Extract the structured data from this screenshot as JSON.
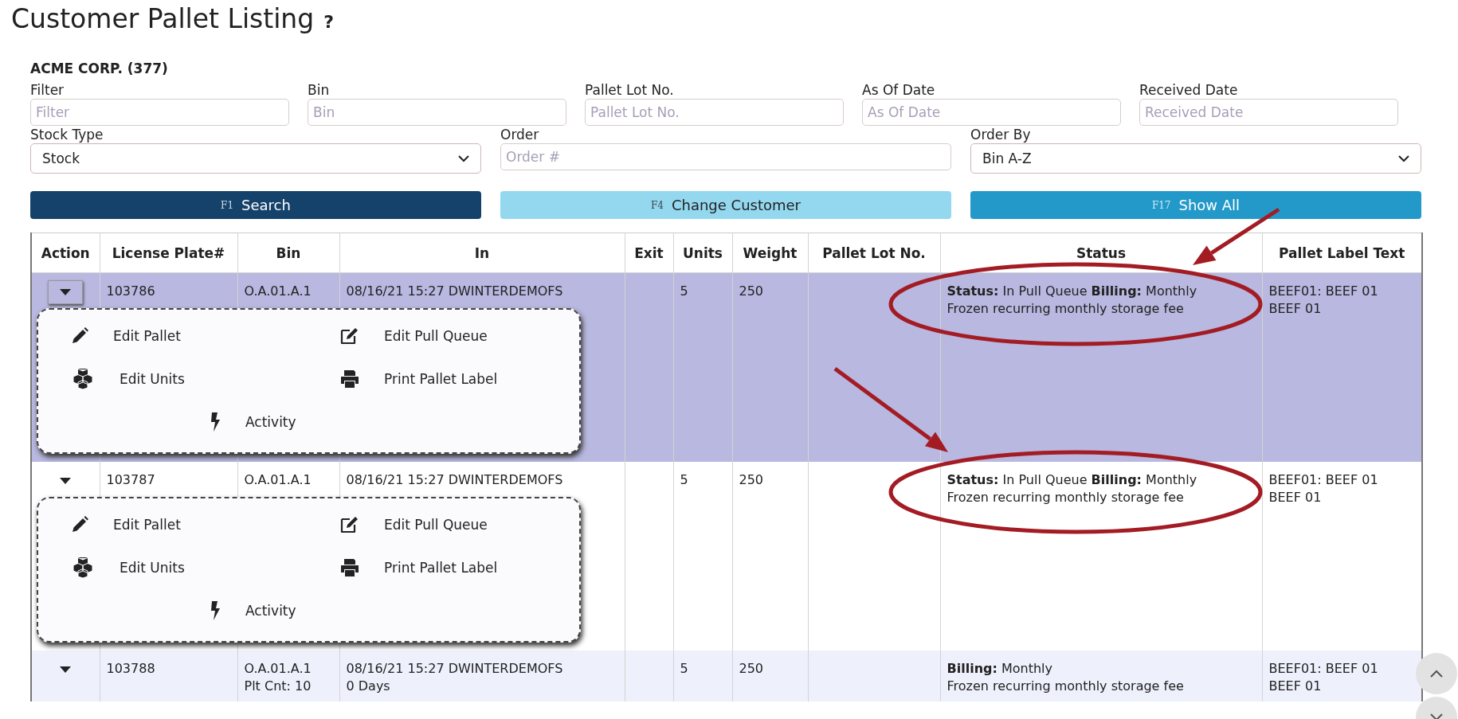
{
  "title": "Customer Pallet Listing",
  "help": "?",
  "customer": "ACME CORP. (377)",
  "filters_top": [
    {
      "kind": "text",
      "label": "Filter",
      "placeholder": "Filter"
    },
    {
      "kind": "text",
      "label": "Bin",
      "placeholder": "Bin"
    },
    {
      "kind": "text",
      "label": "Pallet Lot No.",
      "placeholder": "Pallet Lot No."
    },
    {
      "kind": "text",
      "label": "As Of Date",
      "placeholder": "As Of Date"
    },
    {
      "kind": "text",
      "label": "Received Date",
      "placeholder": "Received Date"
    }
  ],
  "filters_bottom": [
    {
      "kind": "select",
      "label": "Stock Type",
      "value": "Stock"
    },
    {
      "kind": "text",
      "label": "Order",
      "placeholder": "Order #"
    },
    {
      "kind": "select",
      "label": "Order By",
      "value": "Bin A-Z"
    }
  ],
  "buttons": [
    {
      "kind": "primary",
      "key": "F1",
      "label": "Search"
    },
    {
      "kind": "light",
      "key": "F4",
      "label": "Change Customer"
    },
    {
      "kind": "info",
      "key": "F17",
      "label": "Show All"
    }
  ],
  "table": {
    "columns": [
      "Action",
      "License Plate#",
      "Bin",
      "In",
      "Exit",
      "Units",
      "Weight",
      "Pallet Lot No.",
      "Status",
      "Pallet Label Text"
    ],
    "rows": [
      {
        "selected": true,
        "license_plate": "103786",
        "bin": [
          "O.A.01.A.1"
        ],
        "in": [
          "08/16/21 15:27 DWINTERDEMOFS"
        ],
        "units": "5",
        "weight": "250",
        "status": [
          "**Status:** In Pull Queue **Billing:** Monthly",
          "Frozen recurring monthly storage fee"
        ],
        "label_text": [
          "BEEF01: BEEF 01",
          "BEEF 01"
        ],
        "menu": [
          "Edit Pallet",
          "Edit Pull Queue",
          "Edit Units",
          "Print Pallet Label",
          "Activity"
        ]
      },
      {
        "selected": false,
        "license_plate": "103787",
        "bin": [
          "O.A.01.A.1"
        ],
        "in": [
          "08/16/21 15:27 DWINTERDEMOFS"
        ],
        "units": "5",
        "weight": "250",
        "status": [
          "**Status:** In Pull Queue **Billing:** Monthly",
          "Frozen recurring monthly storage fee"
        ],
        "label_text": [
          "BEEF01: BEEF 01",
          "BEEF 01"
        ],
        "menu": [
          "Edit Pallet",
          "Edit Pull Queue",
          "Edit Units",
          "Print Pallet Label",
          "Activity"
        ]
      },
      {
        "selected": false,
        "license_plate": "103788",
        "bin": [
          "O.A.01.A.1",
          "Plt Cnt: 10"
        ],
        "in": [
          "08/16/21 15:27 DWINTERDEMOFS",
          "0 Days"
        ],
        "units": "5",
        "weight": "250",
        "status": [
          "**Billing:** Monthly",
          "Frozen recurring monthly storage fee"
        ],
        "label_text": [
          "BEEF01: BEEF 01",
          "BEEF 01"
        ]
      }
    ]
  }
}
